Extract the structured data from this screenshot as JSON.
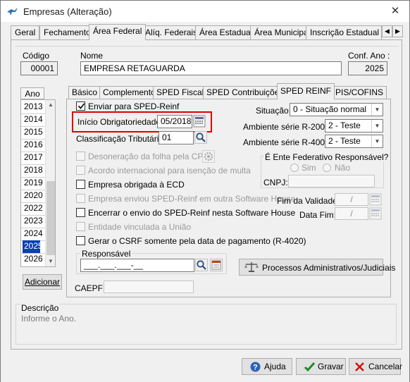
{
  "window": {
    "title": "Empresas (Alteração)"
  },
  "top_tabs": [
    "Geral",
    "Fechamento",
    "Área Federal",
    "Alíq. Federais",
    "Área Estadual",
    "Área Municipal",
    "Inscrição Estadual S"
  ],
  "top_tab_active": "Área Federal",
  "header": {
    "codigo_label": "Código",
    "codigo_value": "00001",
    "nome_label": "Nome",
    "nome_value": "EMPRESA RETAGUARDA",
    "conf_ano_label": "Conf. Ano :",
    "conf_ano_value": "2025"
  },
  "years": {
    "header": "Ano",
    "items": [
      "2013",
      "2014",
      "2015",
      "2016",
      "2017",
      "2018",
      "2019",
      "2020",
      "2022",
      "2023",
      "2024",
      "2025",
      "2026"
    ],
    "selected": "2025",
    "add_button": "Adicionar"
  },
  "inner_tabs": [
    "Básico",
    "Complemento",
    "SPED Fiscal",
    "SPED Contribuições",
    "SPED REINF",
    "PIS/COFINS"
  ],
  "inner_tab_active": "SPED REINF",
  "reinf": {
    "enviar_label": "Enviar para SPED-Reinf",
    "inicio_label": "Início Obrigatoriedade:",
    "inicio_value": "05/2018",
    "classificacao_label": "Classificação Tributária:",
    "classificacao_value": "01",
    "desoneracao_label": "Desoneração da folha pela CPRB",
    "acordo_label": "Acordo internacional para isenção de multa",
    "ecd_label": "Empresa obrigada à ECD",
    "outra_software_label": "Empresa enviou SPED-Reinf em outra Software House",
    "encerrar_label": "Encerrar o envio do SPED-Reinf nesta Software House",
    "entidade_label": "Entidade vinculada a União",
    "csrf_label": "Gerar o CSRF somente pela data de pagamento (R-4020)",
    "situacao_label": "Situação:",
    "situacao_value": "0 - Situação normal",
    "amb_r2000_label": "Ambiente série R-2000:",
    "amb_r2000_value": "2 - Teste",
    "amb_r4000_label": "Ambiente série R-4000:",
    "amb_r4000_value": "2 - Teste",
    "ente_label": "É Ente Federativo Responsável?",
    "sim_label": "Sim",
    "nao_label": "Não",
    "cnpj_label": "CNPJ:",
    "fim_validade_label": "Fim da Validade:",
    "fim_validade_value": "/",
    "data_fim_label": "Data Fim:",
    "data_fim_value": "/",
    "responsavel_label": "Responsável",
    "responsavel_value": "___.___.___-__",
    "processos_button": "Processos Administrativos/Judiciais",
    "caepf_label": "CAEPF:"
  },
  "descricao": {
    "label": "Descrição",
    "text": "Informe o Ano."
  },
  "buttons": {
    "ajuda": "Ajuda",
    "gravar": "Gravar",
    "cancelar": "Cancelar"
  },
  "colors": {
    "highlight": "#e00000",
    "selection": "#0a3fb5"
  }
}
